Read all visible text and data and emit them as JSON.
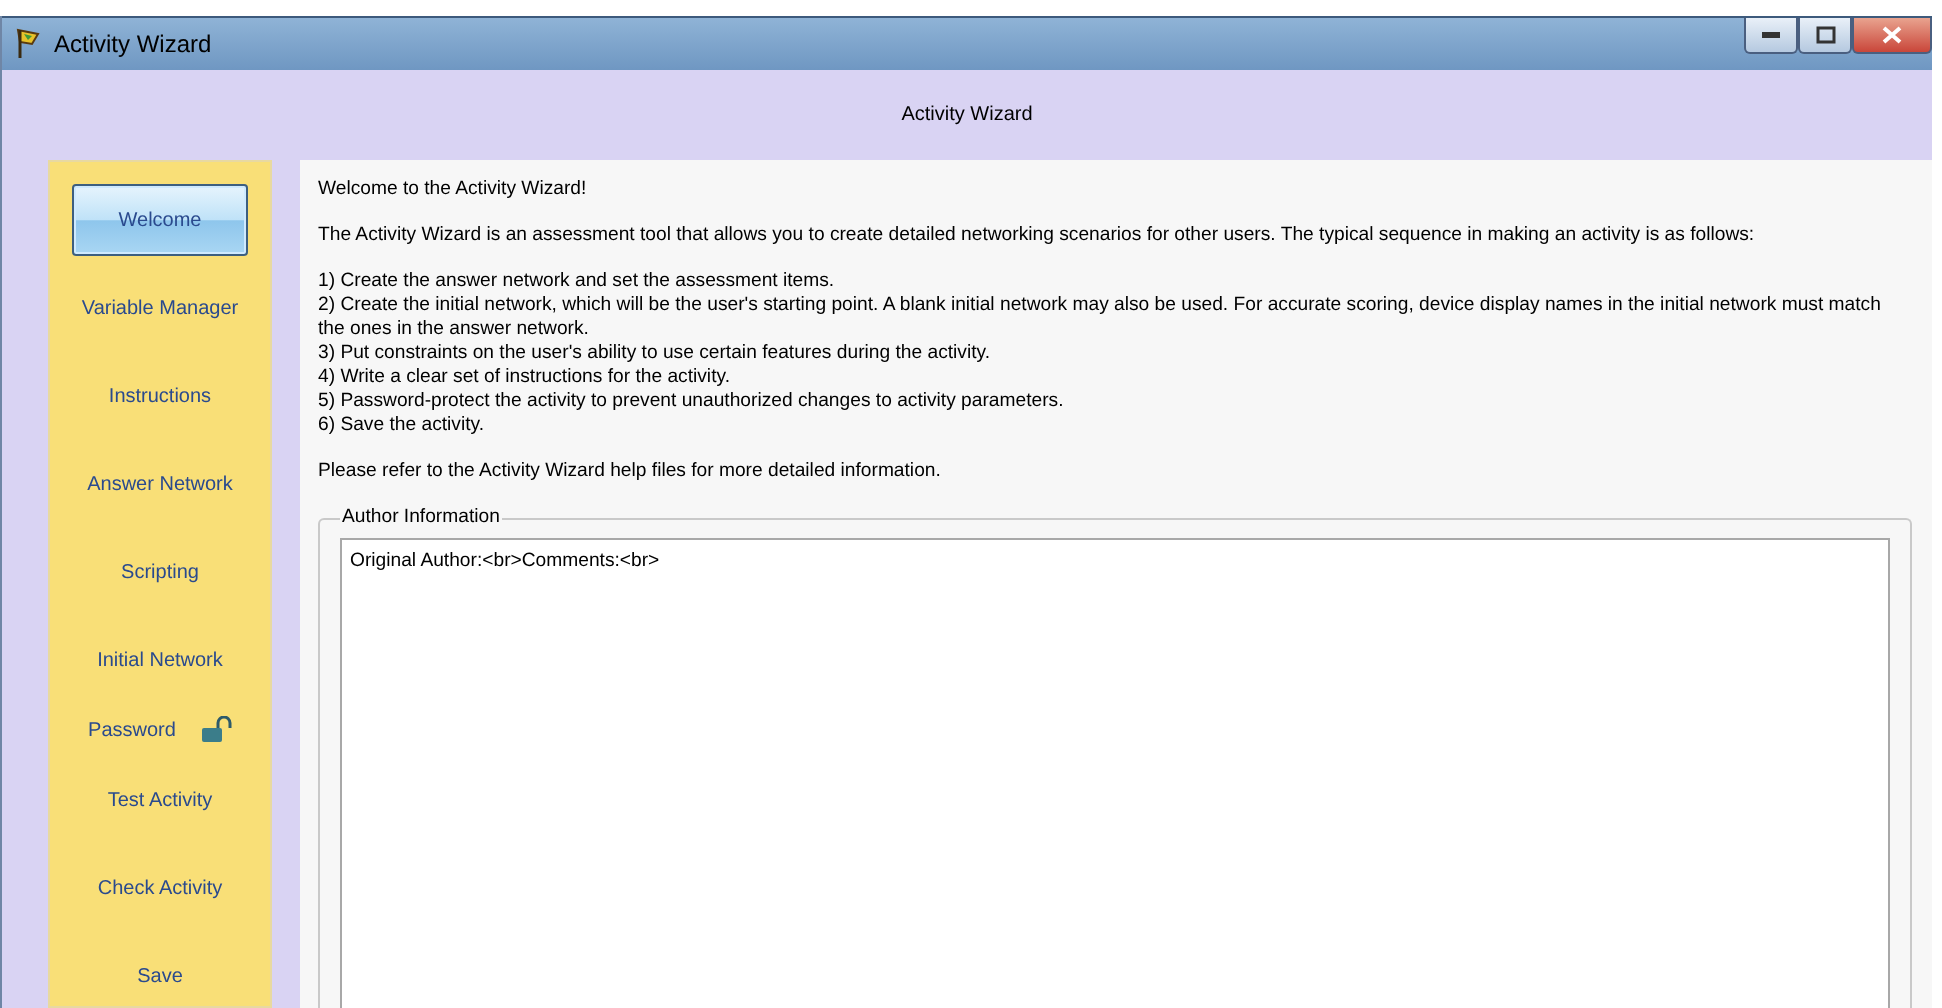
{
  "window": {
    "title": "Activity Wizard"
  },
  "header": {
    "title": "Activity Wizard"
  },
  "sidebar": {
    "items": [
      {
        "label": "Welcome",
        "kind": "plain",
        "selected": true
      },
      {
        "label": "Variable Manager",
        "kind": "plain",
        "selected": false
      },
      {
        "label": "Instructions",
        "kind": "plain",
        "selected": false
      },
      {
        "label": "Answer Network",
        "kind": "plain",
        "selected": false
      },
      {
        "label": "Scripting",
        "kind": "plain",
        "selected": false
      },
      {
        "label": "Initial Network",
        "kind": "plain",
        "selected": false
      },
      {
        "label": "Password",
        "kind": "lock",
        "selected": false
      },
      {
        "label": "Test Activity",
        "kind": "plain",
        "selected": false
      },
      {
        "label": "Check Activity",
        "kind": "plain",
        "selected": false
      },
      {
        "label": "Save",
        "kind": "plain",
        "selected": false
      }
    ]
  },
  "content": {
    "greeting": "Welcome to the Activity Wizard!",
    "intro": "The Activity Wizard is an assessment tool that allows you to create detailed networking scenarios for other users. The typical sequence in making an activity is as follows:",
    "steps": [
      "1) Create the answer network and set the assessment items.",
      "2) Create the initial network, which will be the user's starting point. A blank initial network may also be used. For accurate scoring, device display names in the initial network must match the ones in the answer network.",
      "3) Put constraints on the user's ability to use certain features during the activity.",
      "4) Write a clear set of instructions for the activity.",
      "5) Password-protect the activity to prevent unauthorized changes to activity parameters.",
      "6) Save the activity."
    ],
    "footer": "Please refer to the Activity Wizard help files for more detailed information.",
    "author_group": {
      "title": "Author Information",
      "value": "Original Author:<br>Comments:<br>"
    }
  }
}
